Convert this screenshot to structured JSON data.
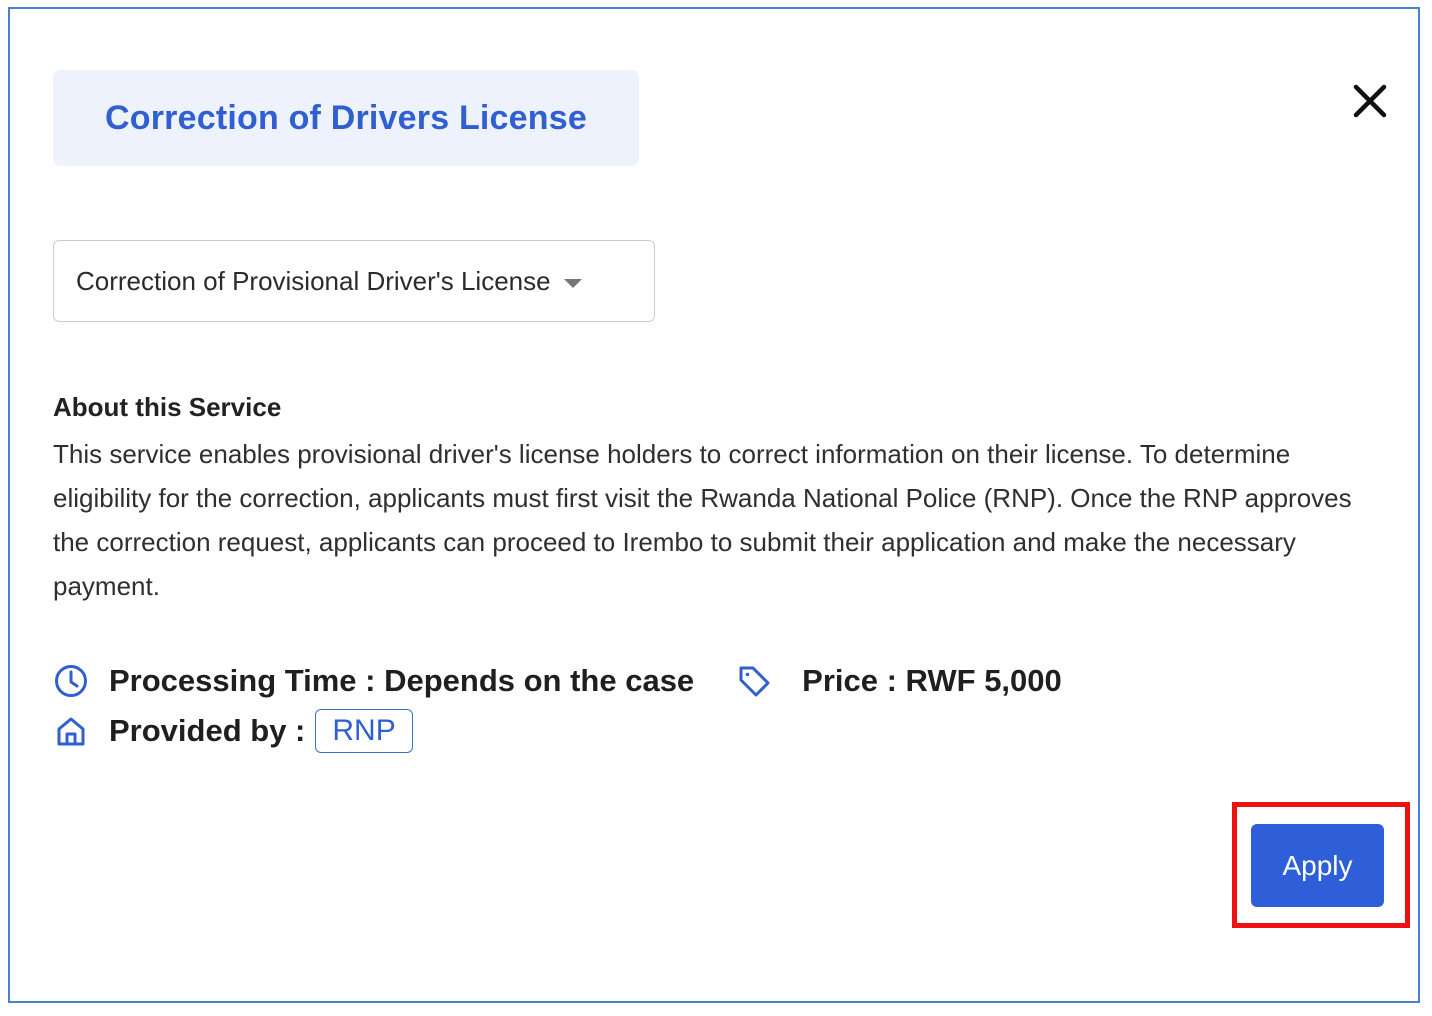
{
  "modal": {
    "title": "Correction of Drivers License",
    "service_select": {
      "selected": "Correction of Provisional Driver's License"
    },
    "about": {
      "heading": "About this Service",
      "text": "This service enables provisional driver's license holders to correct information on their license. To determine eligibility for the correction, applicants must first visit the Rwanda National Police (RNP). Once the RNP approves the correction request, applicants can proceed to Irembo to submit their application and make the necessary payment."
    },
    "info": {
      "processing_time": "Processing Time : Depends on the case",
      "price": "Price : RWF 5,000",
      "provided_by_label": "Provided by :",
      "provider": "RNP"
    },
    "actions": {
      "apply_label": "Apply"
    }
  },
  "icons": {
    "close": "close-icon",
    "caret": "chevron-down-icon",
    "processing": "clock-icon",
    "price": "tag-icon",
    "provider": "home-icon"
  },
  "colors": {
    "accent": "#2f5fd8",
    "title_text": "#2f5fd0",
    "title_bg": "#edf2fc",
    "highlight": "#ee1111",
    "modal_border": "#4a7fd6"
  }
}
